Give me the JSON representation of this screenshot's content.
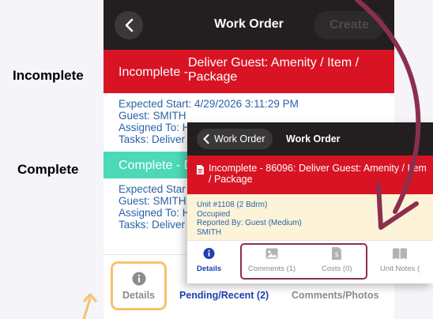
{
  "labels": {
    "incomplete": "Incomplete",
    "complete": "Complete"
  },
  "back_screen": {
    "nav_title": "Work Order",
    "create_label": "Create",
    "incomplete_status": {
      "label": "Incomplete -",
      "description": "Deliver Guest: Amenity / Item / Package"
    },
    "incomplete_info": [
      "Expected Start: 4/29/2026 3:11:29 PM",
      "Guest: SMITH",
      "Assigned To: H",
      "Tasks: Deliver"
    ],
    "complete_status": {
      "label": "Complete - D"
    },
    "complete_info": [
      "Expected Star",
      "Guest: SMITH",
      "Assigned To: H",
      "Tasks: Deliver"
    ],
    "tabs": {
      "details": "Details",
      "pending": "Pending/Recent (2)",
      "comments_photos": "Comments/Photos"
    }
  },
  "front_screen": {
    "back_label": "Work Order",
    "nav_title": "Work Order",
    "status_text": "Incomplete - 86096: Deliver Guest: Amenity / Item / Package",
    "info": [
      "Unit #1108 (2 Bdrm)",
      "Occupied",
      "Reported By: Guest  (Medium)",
      "SMITH"
    ],
    "tabs": {
      "details": "Details",
      "comments": "Comments (1)",
      "costs": "Costs (0)",
      "unit_notes": "Unit Notes ("
    }
  },
  "colors": {
    "incomplete_red": "#d81424",
    "complete_teal": "#4bd9b8",
    "nav_dark": "#231f20",
    "link_blue": "#1f3fb0",
    "info_blue": "#2a62a8",
    "highlight_orange": "#f7c26a",
    "highlight_maroon": "#8c2f4e"
  }
}
